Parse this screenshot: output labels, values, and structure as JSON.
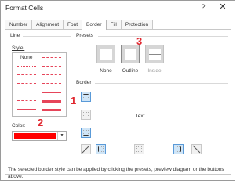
{
  "window": {
    "title": "Format Cells",
    "help_glyph": "?",
    "close_glyph": "✕"
  },
  "tabs": [
    {
      "label": "Number",
      "active": false
    },
    {
      "label": "Alignment",
      "active": false
    },
    {
      "label": "Font",
      "active": false
    },
    {
      "label": "Border",
      "active": true
    },
    {
      "label": "Fill",
      "active": false
    },
    {
      "label": "Protection",
      "active": false
    }
  ],
  "line_group": {
    "heading": "Line",
    "style_label": "Style:",
    "none_label": "None",
    "color_label": "Color:",
    "color_value": "#ff0000"
  },
  "presets": {
    "heading": "Presets",
    "items": [
      {
        "label": "None",
        "enabled": true
      },
      {
        "label": "Outline",
        "enabled": true
      },
      {
        "label": "Inside",
        "enabled": false
      }
    ]
  },
  "border_group": {
    "heading": "Border",
    "preview_text": "Text"
  },
  "callouts": {
    "one": "1",
    "two": "2",
    "three": "3"
  },
  "hint": "The selected border style can be applied by clicking the presets, preview diagram or the buttons above.",
  "colors": {
    "accent_red": "#e0262e",
    "line_red": "#e6455a",
    "selected_blue": "#cfe5f7"
  }
}
